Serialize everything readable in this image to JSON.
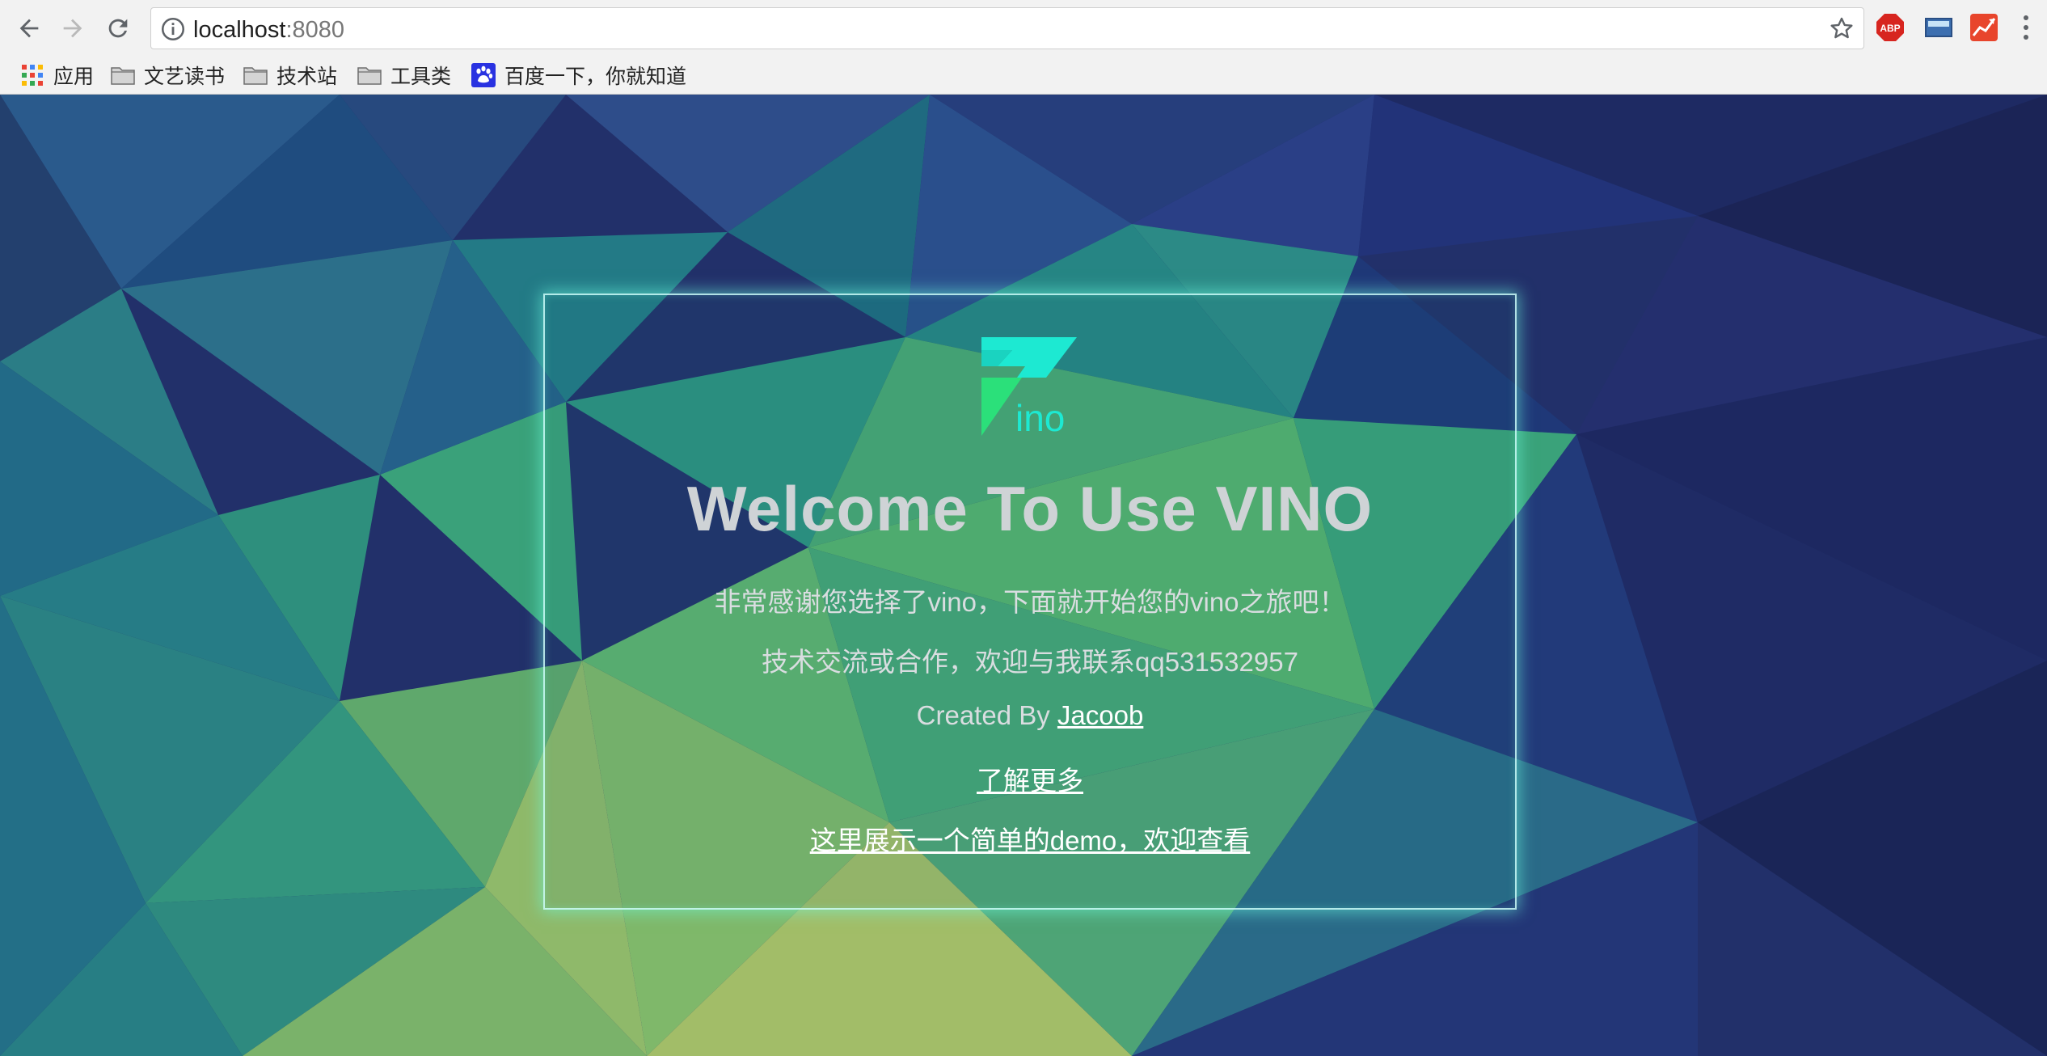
{
  "browser": {
    "url_host": "localhost",
    "url_port": ":8080",
    "icons": {
      "back": "arrow-left-icon",
      "forward": "arrow-right-icon",
      "reload": "reload-icon",
      "site_info": "info-icon",
      "bookmark_star": "star-icon",
      "menu": "more-vert-icon"
    },
    "extensions": [
      {
        "name": "adblock-plus",
        "label": "ABP"
      },
      {
        "name": "screen-extension"
      },
      {
        "name": "chart-extension"
      }
    ]
  },
  "bookmarks": [
    {
      "label": "应用",
      "icon": "apps-grid-icon"
    },
    {
      "label": "文艺读书",
      "icon": "folder-icon"
    },
    {
      "label": "技术站",
      "icon": "folder-icon"
    },
    {
      "label": "工具类",
      "icon": "folder-icon"
    },
    {
      "label": "百度一下，你就知道",
      "icon": "baidu-paw-icon"
    }
  ],
  "page": {
    "logo_text": "ino",
    "title": "Welcome To Use VINO",
    "subtitle": "非常感谢您选择了vino，下面就开始您的vino之旅吧！",
    "contact": "技术交流或合作，欢迎与我联系qq531532957",
    "created_by_prefix": "Created By ",
    "author_link": "Jacoob",
    "learn_more_link": "了解更多",
    "demo_link": "这里展示一个简单的demo，欢迎查看"
  },
  "colors": {
    "accent_cyan": "#1de9d2",
    "accent_green": "#2be07a",
    "background_navy": "#22306a",
    "card_border": "#cdfffa"
  }
}
